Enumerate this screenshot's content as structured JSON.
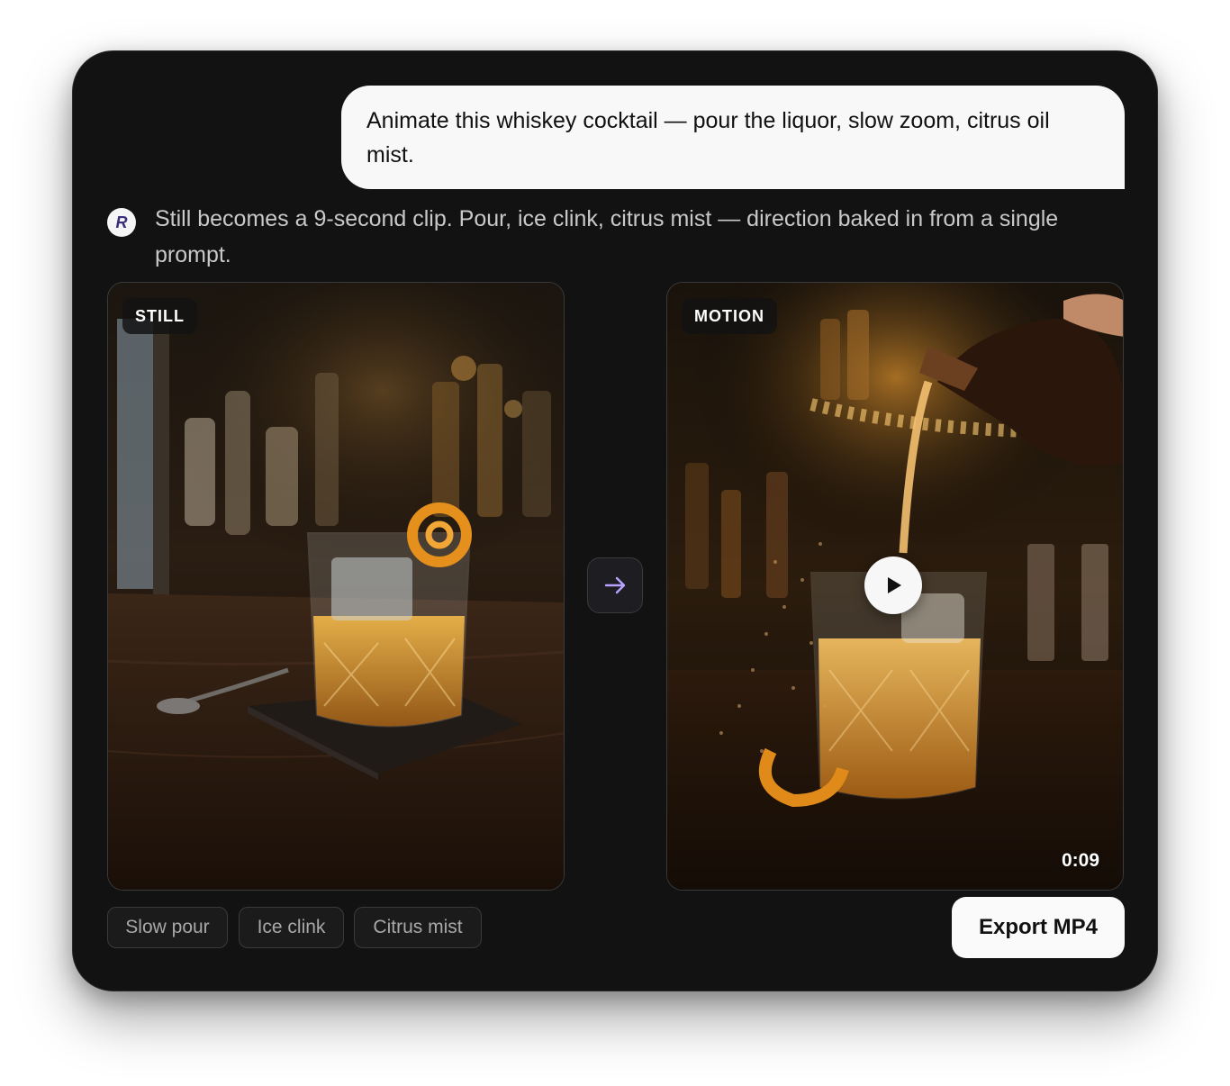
{
  "conversation": {
    "user_message": "Animate this whiskey cocktail — pour the liquor, slow zoom, citrus oil mist.",
    "assistant_avatar_letter": "R",
    "assistant_message": "Still becomes a 9-second clip. Pour, ice clink, citrus mist — direction baked in from a single prompt."
  },
  "still_panel": {
    "tag": "STILL"
  },
  "motion_panel": {
    "tag": "MOTION",
    "duration": "0:09"
  },
  "chips": [
    "Slow pour",
    "Ice clink",
    "Citrus mist"
  ],
  "actions": {
    "export_label": "Export MP4"
  },
  "icons": {
    "transform": "arrow-right-icon",
    "play": "play-icon"
  },
  "colors": {
    "card_bg": "#121212",
    "bubble_bg": "#f8f8f8",
    "accent": "#b9a2ff"
  }
}
